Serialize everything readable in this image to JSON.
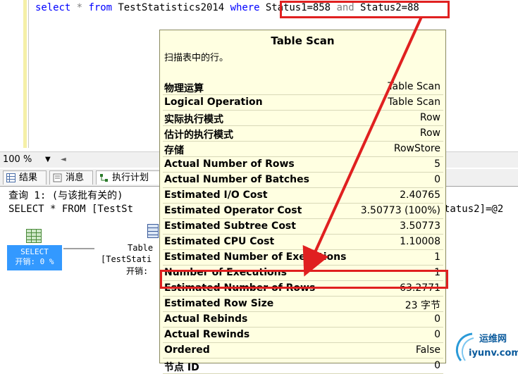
{
  "editor": {
    "sql_select": "select",
    "sql_star": "*",
    "sql_from": "from",
    "sql_table": "TestStatistics2014",
    "sql_where": "where",
    "sql_cond1": "Status1=858",
    "sql_and": "and",
    "sql_cond2": "Status2=88"
  },
  "zoom": {
    "value": "100 %"
  },
  "tabs": [
    {
      "label": "结果"
    },
    {
      "label": "消息"
    },
    {
      "label": "执行计划"
    }
  ],
  "results": {
    "query_line": "查询 1: (与该批有关的)",
    "sql_line": "SELECT * FROM [TestSt",
    "sql_line_right": "tatus2]=@2"
  },
  "plan": {
    "select_node": {
      "label": "SELECT",
      "cost": "开销: 0 %"
    },
    "scan_node": {
      "label": "Table",
      "label2": "[TestStati",
      "cost": "开销:"
    }
  },
  "tooltip": {
    "title": "Table Scan",
    "description": "扫描表中的行。",
    "rows": [
      {
        "key": "物理运算",
        "value": "Table Scan"
      },
      {
        "key": "Logical Operation",
        "value": "Table Scan"
      },
      {
        "key": "实际执行模式",
        "value": "Row"
      },
      {
        "key": "估计的执行模式",
        "value": "Row"
      },
      {
        "key": "存储",
        "value": "RowStore"
      },
      {
        "key": "Actual Number of Rows",
        "value": "5"
      },
      {
        "key": "Actual Number of Batches",
        "value": "0"
      },
      {
        "key": "Estimated I/O Cost",
        "value": "2.40765"
      },
      {
        "key": "Estimated Operator Cost",
        "value": "3.50773 (100%)"
      },
      {
        "key": "Estimated Subtree Cost",
        "value": "3.50773"
      },
      {
        "key": "Estimated CPU Cost",
        "value": "1.10008"
      },
      {
        "key": "Estimated Number of Executions",
        "value": "1"
      },
      {
        "key": "Number of Executions",
        "value": "1"
      },
      {
        "key": "Estimated Number of Rows",
        "value": "63.2771"
      },
      {
        "key": "Estimated Row Size",
        "value": "23 字节"
      },
      {
        "key": "Actual Rebinds",
        "value": "0"
      },
      {
        "key": "Actual Rewinds",
        "value": "0"
      },
      {
        "key": "Ordered",
        "value": "False"
      },
      {
        "key": "节点 ID",
        "value": "0"
      }
    ]
  },
  "watermark": {
    "line1": "运维网",
    "line2": "iyunv.com"
  },
  "colors": {
    "highlight": "#e02020",
    "tooltip_bg": "#ffffe1",
    "keyword": "#0000ff",
    "selected_node": "#3399ff"
  }
}
